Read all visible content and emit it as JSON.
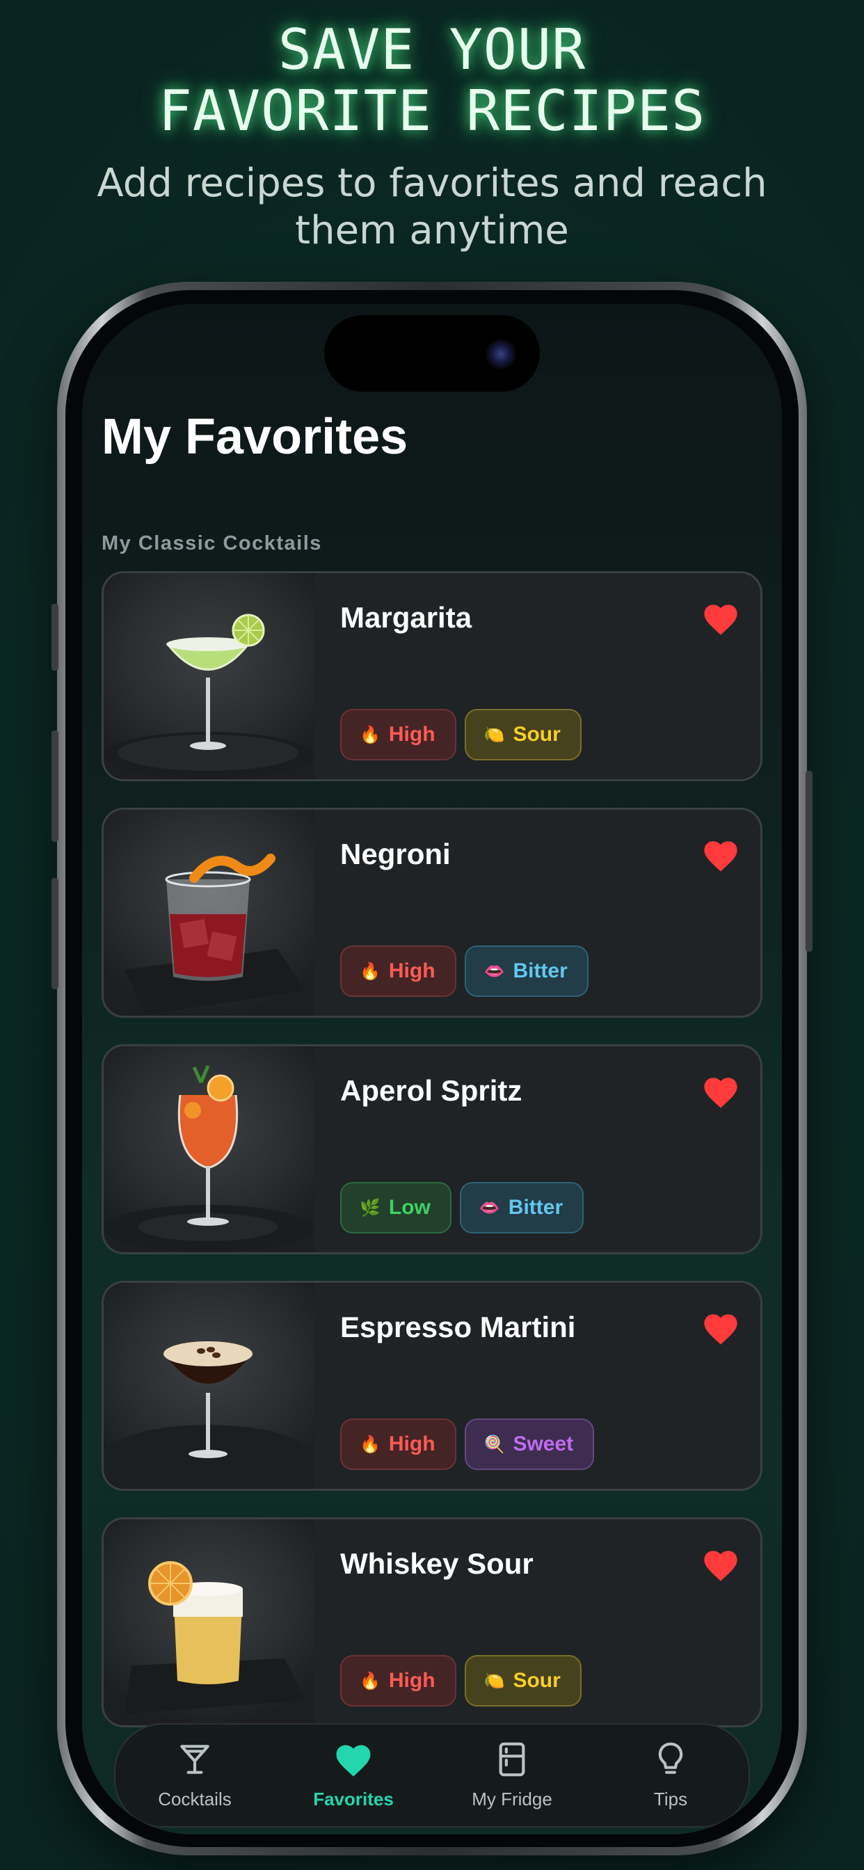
{
  "promo": {
    "headline_line1": "SAVE YOUR",
    "headline_line2": "FAVORITE RECIPES",
    "subheadline": "Add recipes to favorites and reach them anytime"
  },
  "screen": {
    "title": "My Favorites",
    "section_label": "My Classic Cocktails"
  },
  "favorites": [
    {
      "name": "Margarita",
      "tags": [
        {
          "label": "High",
          "icon": "fire-icon",
          "kind": "high"
        },
        {
          "label": "Sour",
          "icon": "lemon-icon",
          "kind": "sour"
        }
      ],
      "image": "margarita-photo"
    },
    {
      "name": "Negroni",
      "tags": [
        {
          "label": "High",
          "icon": "fire-icon",
          "kind": "high"
        },
        {
          "label": "Bitter",
          "icon": "lips-icon",
          "kind": "bitter"
        }
      ],
      "image": "negroni-photo"
    },
    {
      "name": "Aperol Spritz",
      "tags": [
        {
          "label": "Low",
          "icon": "herb-icon",
          "kind": "low"
        },
        {
          "label": "Bitter",
          "icon": "lips-icon",
          "kind": "bitter"
        }
      ],
      "image": "aperol-spritz-photo"
    },
    {
      "name": "Espresso Martini",
      "tags": [
        {
          "label": "High",
          "icon": "fire-icon",
          "kind": "high"
        },
        {
          "label": "Sweet",
          "icon": "lollipop-icon",
          "kind": "sweet"
        }
      ],
      "image": "espresso-martini-photo"
    },
    {
      "name": "Whiskey Sour",
      "tags": [
        {
          "label": "High",
          "icon": "fire-icon",
          "kind": "high"
        },
        {
          "label": "Sour",
          "icon": "lemon-icon",
          "kind": "sour"
        }
      ],
      "image": "whiskey-sour-photo"
    }
  ],
  "tabbar": {
    "items": [
      {
        "label": "Cocktails",
        "icon": "cocktail-glass-icon",
        "active": false
      },
      {
        "label": "Favorites",
        "icon": "heart-icon",
        "active": true
      },
      {
        "label": "My Fridge",
        "icon": "fridge-icon",
        "active": false
      },
      {
        "label": "Tips",
        "icon": "lightbulb-icon",
        "active": false
      }
    ]
  },
  "colors": {
    "accent": "#23d6ad",
    "heart": "#ff3b3b",
    "card_bg": "#1f2325",
    "tag_high": "#ff5b55",
    "tag_low": "#3fd164",
    "tag_sour": "#f6cf2a",
    "tag_bitter": "#62c7ee",
    "tag_sweet": "#c06cf0"
  }
}
